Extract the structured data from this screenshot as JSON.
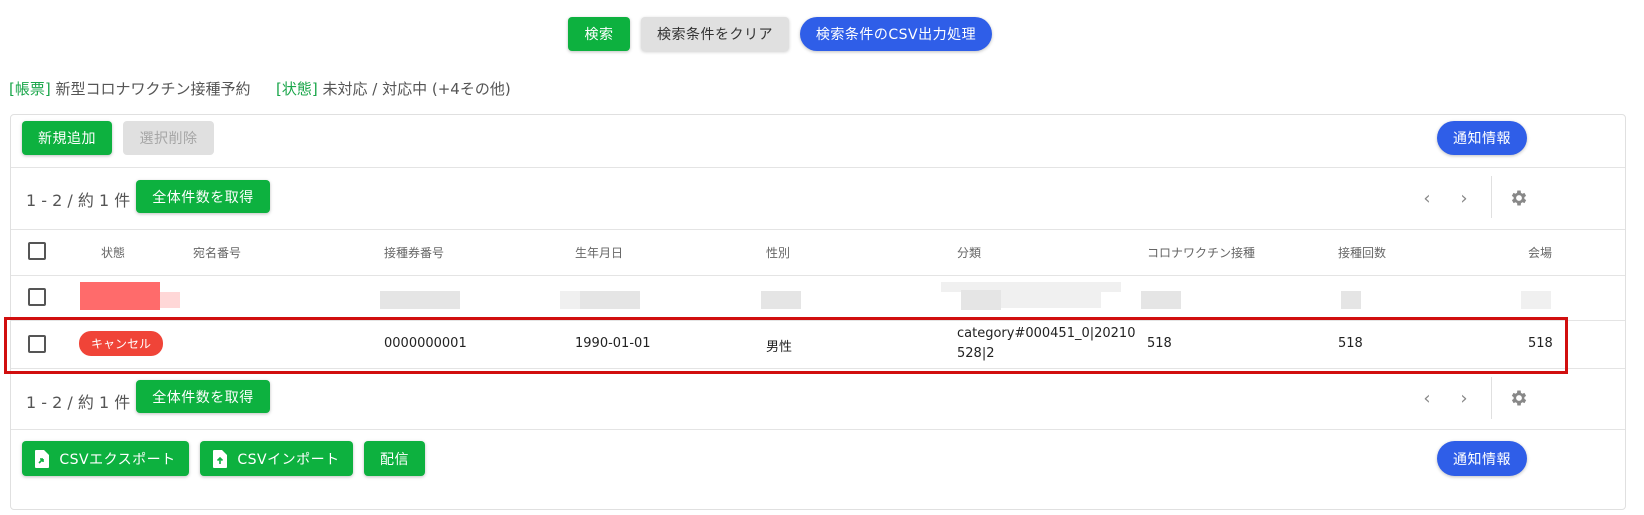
{
  "search_bar": {
    "search": "検索",
    "clear": "検索条件をクリア",
    "csv_output": "検索条件のCSV出力処理"
  },
  "filters": {
    "form_key": "[帳票]",
    "form_value": "新型コロナワクチン接種予約",
    "status_key": "[状態]",
    "status_value": "未対応 / 対応中 (+4その他)"
  },
  "toolbar": {
    "add_new": "新規追加",
    "delete_selected": "選択削除",
    "notification_info": "通知情報"
  },
  "pagination": {
    "count_text": "1 - 2 / 約 1 件",
    "get_total": "全体件数を取得"
  },
  "table": {
    "columns": [
      "状態",
      "宛名番号",
      "接種券番号",
      "生年月日",
      "性別",
      "分類",
      "コロナワクチン接種",
      "接種回数",
      "会場"
    ],
    "rows": [
      {
        "status": "キャンセル",
        "addressee_no": "",
        "ticket_no": "0000000001",
        "birth_date": "1990-01-01",
        "gender": "男性",
        "category_line1": "category#000451_0|20210",
        "category_line2": "528|2",
        "vaccine": "518",
        "times": "518",
        "venue": "518"
      }
    ]
  },
  "footer": {
    "csv_export": "CSVエクスポート",
    "csv_import": "CSVインポート",
    "deliver": "配信",
    "notification_info": "通知情報"
  },
  "colors": {
    "green": "#0db13f",
    "blue": "#2f5ee8",
    "badge_red": "#f04438",
    "highlight": "#d10f0f"
  }
}
